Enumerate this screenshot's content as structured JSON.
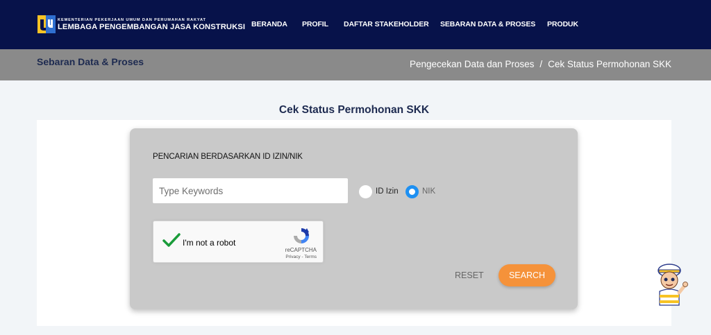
{
  "header": {
    "logo_small": "KEMENTERIAN PEKERJAAN UMUM DAN PERUMAHAN RAKYAT",
    "logo_big": "LEMBAGA PENGEMBANGAN JASA KONSTRUKSI",
    "nav": [
      "BERANDA",
      "PROFIL",
      "DAFTAR STAKEHOLDER",
      "SEBARAN DATA & PROSES",
      "PRODUK"
    ]
  },
  "breadcrumb": {
    "section_title": "Sebaran Data & Proses",
    "path": [
      "Pengecekan Data dan Proses",
      "Cek Status Permohonan SKK"
    ],
    "separator": "/"
  },
  "page": {
    "heading": "Cek Status Permohonan SKK"
  },
  "form": {
    "label": "PENCARIAN BERDASARKAN ID IZIN/NIK",
    "input_placeholder": "Type Keywords",
    "input_value": "",
    "radio_options": [
      "ID Izin",
      "NIK"
    ],
    "radio_selected": "NIK",
    "reset_label": "RESET",
    "search_label": "SEARCH"
  },
  "captcha": {
    "text": "I'm not a robot",
    "brand": "reCAPTCHA",
    "links": "Privacy - Terms",
    "checked": true
  },
  "colors": {
    "topbar": "#07124a",
    "breadcrumb_bar": "#8a8a8a",
    "search_button": "#f5923a",
    "radio_selected": "#1e90f2",
    "logo_yellow": "#f7c325"
  },
  "icons": [
    "pupr-logo-icon",
    "checkmark-icon",
    "recaptcha-icon",
    "mascot-icon"
  ]
}
